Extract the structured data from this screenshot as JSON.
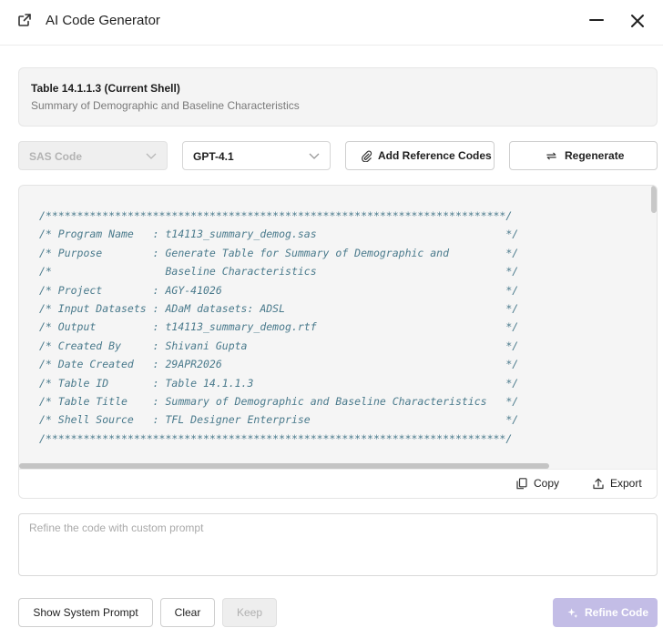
{
  "header": {
    "title": "AI Code Generator"
  },
  "table_info": {
    "title": "Table 14.1.1.3 (Current Shell)",
    "subtitle": "Summary of Demographic and Baseline Characteristics"
  },
  "controls": {
    "language": {
      "selected": "SAS Code",
      "disabled": true
    },
    "model": {
      "selected": "GPT-4.1"
    },
    "add_reference_label": "Add Reference Codes",
    "regenerate_label": "Regenerate"
  },
  "code": {
    "lines": [
      "/*************************************************************************/",
      "/* Program Name   : t14113_summary_demog.sas                              */",
      "/* Purpose        : Generate Table for Summary of Demographic and         */",
      "/*                  Baseline Characteristics                              */",
      "/* Project        : AGY-41026                                             */",
      "/* Input Datasets : ADaM datasets: ADSL                                   */",
      "/* Output         : t14113_summary_demog.rtf                              */",
      "/* Created By     : Shivani Gupta                                         */",
      "/* Date Created   : 29APR2026                                             */",
      "/* Table ID       : Table 14.1.1.3                                        */",
      "/* Table Title    : Summary of Demographic and Baseline Characteristics   */",
      "/* Shell Source   : TFL Designer Enterprise                               */",
      "/*************************************************************************/"
    ],
    "copy_label": "Copy",
    "export_label": "Export"
  },
  "prompt": {
    "placeholder": "Refine the code with custom prompt",
    "value": ""
  },
  "footer": {
    "show_system_prompt_label": "Show System Prompt",
    "clear_label": "Clear",
    "keep_label": "Keep",
    "refine_label": "Refine Code"
  },
  "colors": {
    "code_text": "#4a7a8c",
    "refine_button": "#c3bde6",
    "card_background": "#f4f4f4"
  },
  "icons": [
    "external-link-icon",
    "minimize-icon",
    "close-icon",
    "chevron-down-icon",
    "paperclip-icon",
    "refresh-icon",
    "copy-icon",
    "export-icon",
    "sparkle-icon"
  ]
}
